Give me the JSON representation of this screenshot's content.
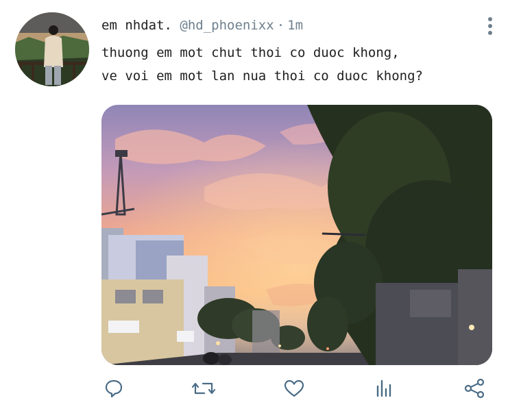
{
  "tweet": {
    "display_name": "em nhdat.",
    "handle": "@hd_phoenixx",
    "separator": "·",
    "time": "1m",
    "text_line1": "thuong em mot chut thoi co duoc khong,",
    "text_line2": "ve voi em mot lan nua thoi co duoc khong?"
  },
  "colors": {
    "text": "#1e1e1e",
    "muted": "#6e7f8d",
    "icon": "#4a6b85"
  },
  "icons": {
    "more": "vertical-dots-icon",
    "reply": "reply-bubble-icon",
    "retweet": "retweet-icon",
    "like": "heart-icon",
    "stats": "bar-stats-icon",
    "share": "share-nodes-icon"
  }
}
